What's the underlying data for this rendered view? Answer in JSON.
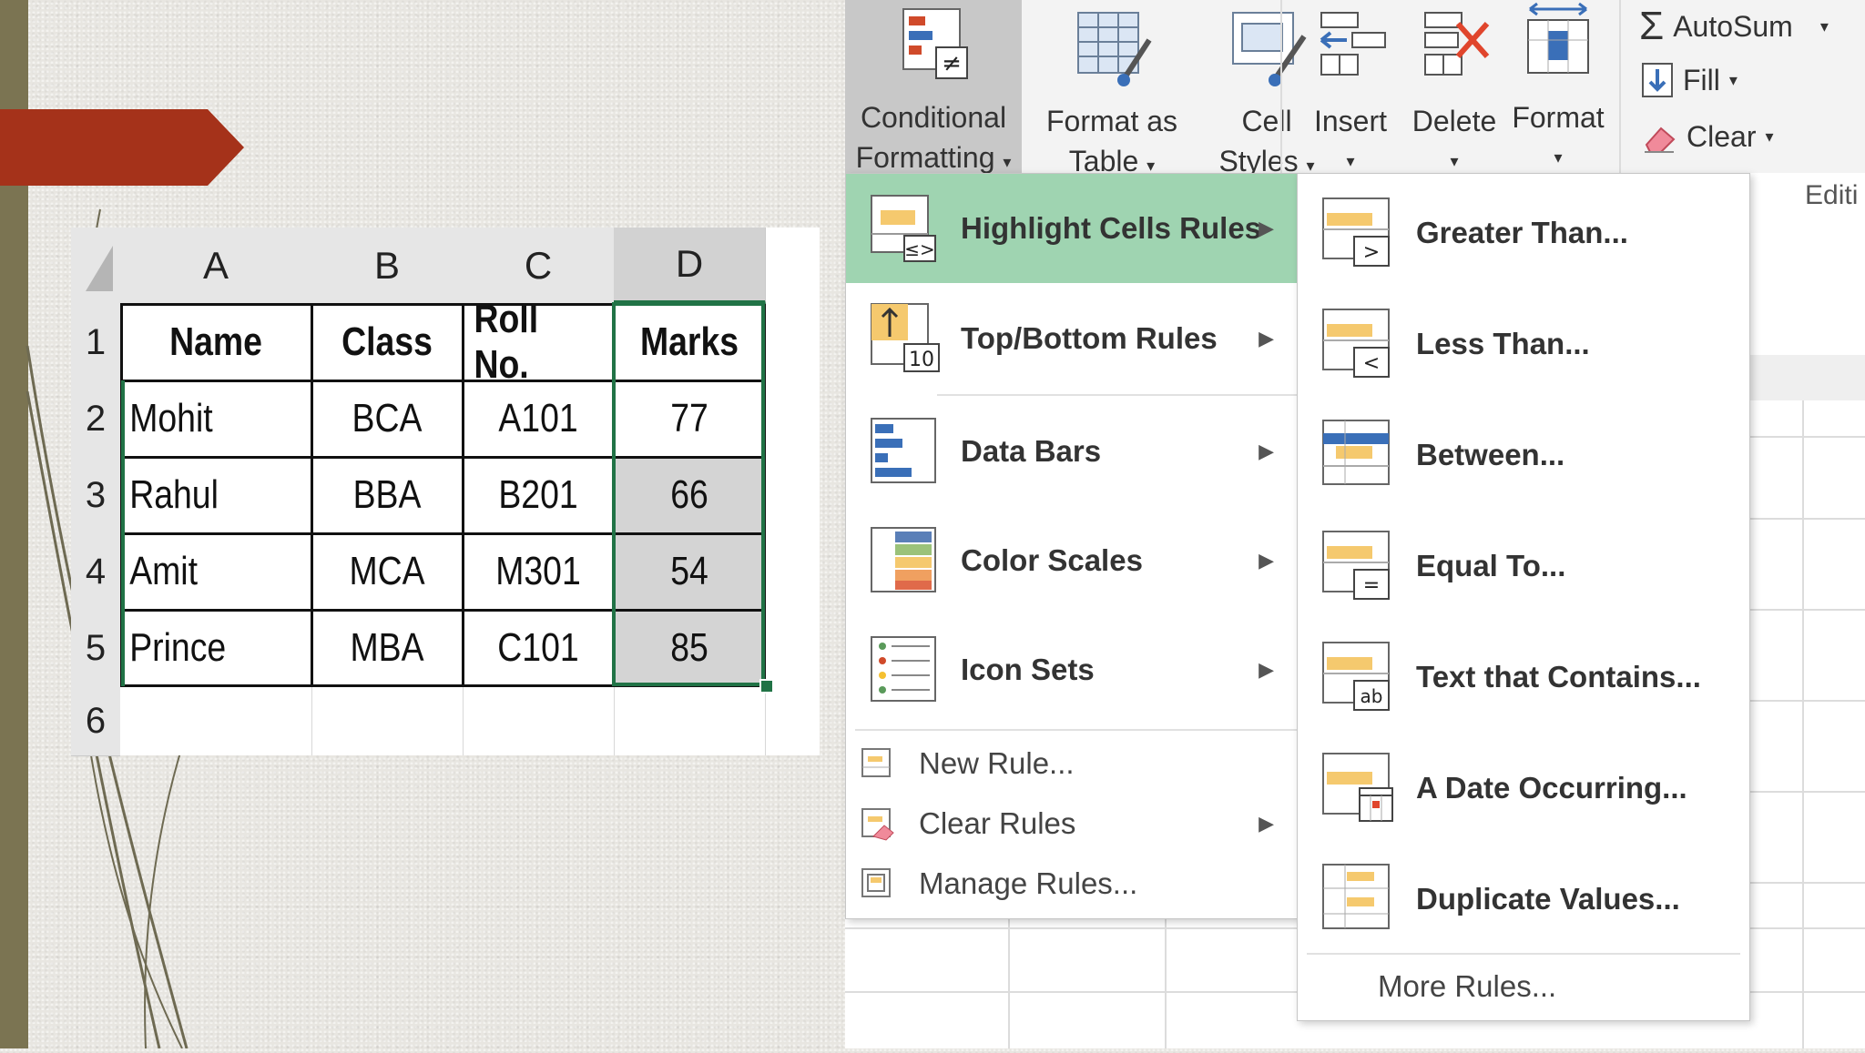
{
  "sheet": {
    "col_headers": [
      "A",
      "B",
      "C",
      "D"
    ],
    "row_headers": [
      "1",
      "2",
      "3",
      "4",
      "5",
      "6"
    ],
    "rows": [
      [
        "Name",
        "Class",
        "Roll No.",
        "Marks"
      ],
      [
        "Mohit",
        "BCA",
        "A101",
        "77"
      ],
      [
        "Rahul",
        "BBA",
        "B201",
        "66"
      ],
      [
        "Amit",
        "MCA",
        "M301",
        "54"
      ],
      [
        "Prince",
        "MBA",
        "C101",
        "85"
      ]
    ],
    "selection_color": "#217346"
  },
  "ribbon": {
    "conditional_formatting": {
      "line1": "Conditional",
      "line2": "Formatting"
    },
    "format_as_table": {
      "line1": "Format as",
      "line2": "Table"
    },
    "cell_styles": {
      "line1": "Cell",
      "line2": "Styles"
    },
    "insert": "Insert",
    "delete": "Delete",
    "format": "Format",
    "autosum": "AutoSum",
    "fill": "Fill",
    "clear": "Clear",
    "editing_group": "Editi"
  },
  "menu": {
    "items": [
      {
        "label": "Highlight Cells Rules",
        "icon": "highlight-cells-rules-icon"
      },
      {
        "label": "Top/Bottom Rules",
        "icon": "top-bottom-rules-icon"
      },
      {
        "label": "Data Bars",
        "icon": "data-bars-icon"
      },
      {
        "label": "Color Scales",
        "icon": "color-scales-icon"
      },
      {
        "label": "Icon Sets",
        "icon": "icon-sets-icon"
      }
    ],
    "new_rule": "New Rule...",
    "clear_rules": "Clear Rules",
    "manage_rules": "Manage Rules..."
  },
  "submenu": {
    "items": [
      {
        "label": "Greater Than...",
        "icon": "greater-than-icon"
      },
      {
        "label": "Less Than...",
        "icon": "less-than-icon"
      },
      {
        "label": "Between...",
        "icon": "between-icon"
      },
      {
        "label": "Equal To...",
        "icon": "equal-to-icon"
      },
      {
        "label": "Text that Contains...",
        "icon": "text-contains-icon"
      },
      {
        "label": "A Date Occurring...",
        "icon": "date-occurring-icon"
      },
      {
        "label": "Duplicate Values...",
        "icon": "duplicate-values-icon"
      }
    ],
    "more_rules": "More Rules..."
  },
  "colors": {
    "highlight": "#9fd4b1",
    "accent_red": "#a5321a",
    "excel_green": "#217346"
  }
}
